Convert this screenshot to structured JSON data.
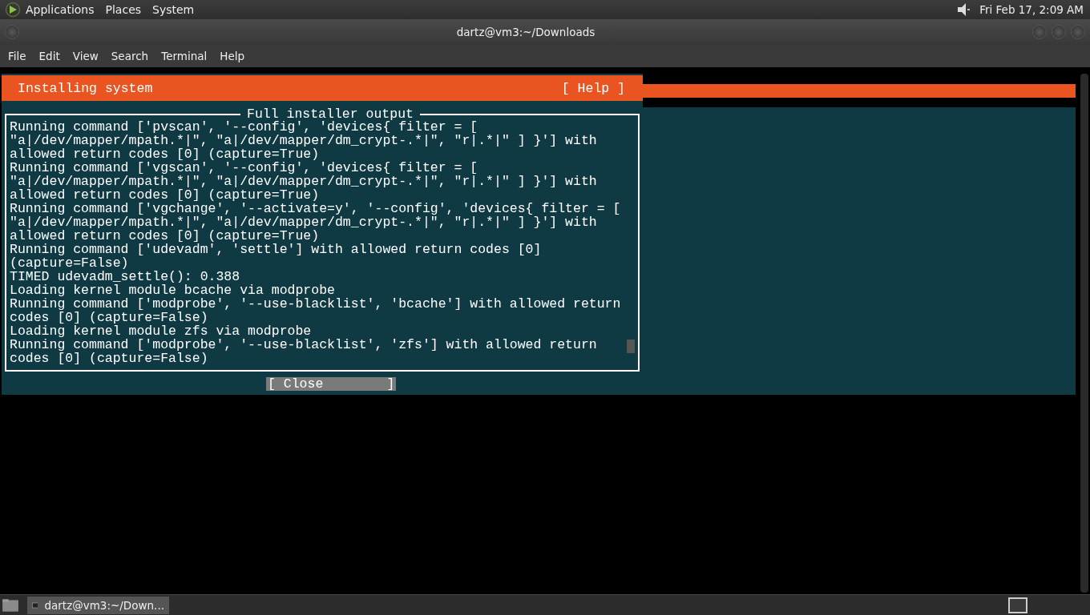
{
  "top_panel": {
    "menus": [
      "Applications",
      "Places",
      "System"
    ],
    "clock": "Fri Feb 17,  2:09 AM"
  },
  "window": {
    "title": "dartz@vm3:~/Downloads"
  },
  "menu_bar": [
    "File",
    "Edit",
    "View",
    "Search",
    "Terminal",
    "Help"
  ],
  "installer": {
    "header": "Installing system",
    "help": "[ Help ]",
    "dialog": {
      "title": "Full installer output",
      "lines": [
        "Running command ['pvscan', '--config', 'devices{ filter = [",
        "\"a|/dev/mapper/mpath.*|\", \"a|/dev/mapper/dm_crypt-.*|\", \"r|.*|\" ] }'] with",
        "allowed return codes [0] (capture=True)",
        "Running command ['vgscan', '--config', 'devices{ filter = [",
        "\"a|/dev/mapper/mpath.*|\", \"a|/dev/mapper/dm_crypt-.*|\", \"r|.*|\" ] }'] with",
        "allowed return codes [0] (capture=True)",
        "Running command ['vgchange', '--activate=y', '--config', 'devices{ filter = [",
        "\"a|/dev/mapper/mpath.*|\", \"a|/dev/mapper/dm_crypt-.*|\", \"r|.*|\" ] }'] with",
        "allowed return codes [0] (capture=True)",
        "Running command ['udevadm', 'settle'] with allowed return codes [0]",
        "(capture=False)",
        "TIMED udevadm_settle(): 0.388",
        "Loading kernel module bcache via modprobe",
        "Running command ['modprobe', '--use-blacklist', 'bcache'] with allowed return",
        "codes [0] (capture=False)",
        "Loading kernel module zfs via modprobe",
        "Running command ['modprobe', '--use-blacklist', 'zfs'] with allowed return",
        "codes [0] (capture=False)"
      ],
      "close_button": "[ Close        ]"
    }
  },
  "taskbar": {
    "task": "dartz@vm3:~/Down..."
  }
}
